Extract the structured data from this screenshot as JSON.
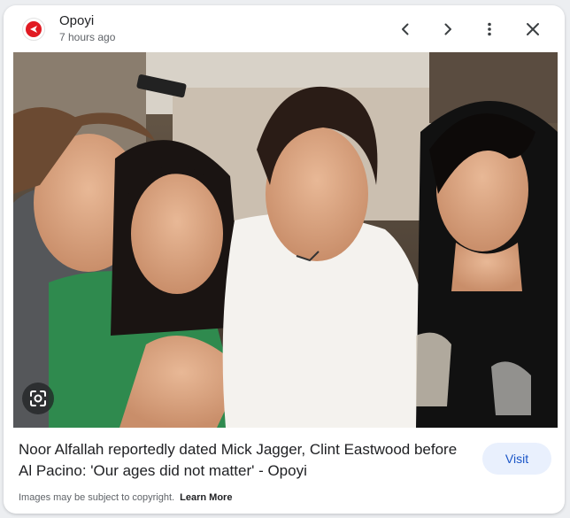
{
  "header": {
    "source_name": "Opoyi",
    "time_ago": "7 hours ago",
    "logo_icon": "opoyi-logo-icon"
  },
  "controls": {
    "prev_icon": "chevron-left-icon",
    "next_icon": "chevron-right-icon",
    "more_icon": "more-vert-icon",
    "close_icon": "close-icon",
    "lens_icon": "google-lens-icon"
  },
  "caption": {
    "title": "Noor Alfallah reportedly dated Mick Jagger, Clint Eastwood before Al Pacino: 'Our ages did not matter' - Opoyi",
    "visit_label": "Visit"
  },
  "footer": {
    "copyright_notice": "Images may be subject to copyright.",
    "learn_more": "Learn More"
  },
  "colors": {
    "brand_red": "#e11a22",
    "visit_bg": "#e9f0fd",
    "visit_text": "#1a55c7"
  }
}
